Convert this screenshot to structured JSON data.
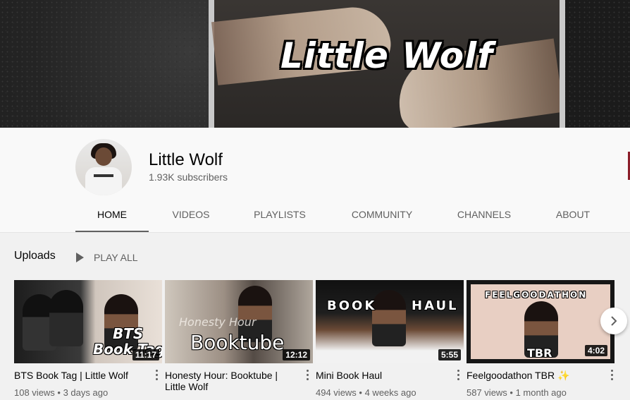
{
  "channel": {
    "banner_title": "Little Wolf",
    "name": "Little Wolf",
    "subscribers": "1.93K subscribers"
  },
  "tabs": [
    {
      "label": "HOME"
    },
    {
      "label": "VIDEOS"
    },
    {
      "label": "PLAYLISTS"
    },
    {
      "label": "COMMUNITY"
    },
    {
      "label": "CHANNELS"
    },
    {
      "label": "ABOUT"
    }
  ],
  "uploads": {
    "title": "Uploads",
    "play_all": "PLAY ALL",
    "videos": [
      {
        "title": "BTS Book Tag | Little Wolf",
        "views": "108 views",
        "age": "3 days ago",
        "duration": "11:17",
        "thumb_text_1": "BTS",
        "thumb_text_2": "Book Tag"
      },
      {
        "title": "Honesty Hour: Booktube | Little Wolf",
        "views": "",
        "age": "",
        "duration": "12:12",
        "thumb_text_1": "Booktube",
        "thumb_text_2": "Honesty Hour"
      },
      {
        "title": "Mini Book Haul",
        "views": "494 views",
        "age": "4 weeks ago",
        "duration": "5:55",
        "thumb_text_1": "BOOK",
        "thumb_text_2": "HAUL"
      },
      {
        "title": "Feelgoodathon TBR ✨",
        "views": "587 views",
        "age": "1 month ago",
        "duration": "4:02",
        "thumb_text_1": "FEELGOODATHON",
        "thumb_text_2": "TBR"
      }
    ]
  },
  "colors": {
    "accent_active_tab": "#606060",
    "background": "#f9f9f9",
    "section_bg": "#f1f1f1"
  },
  "icons": {
    "play": "play-icon",
    "more": "more-vert-icon",
    "next": "chevron-right-icon"
  }
}
